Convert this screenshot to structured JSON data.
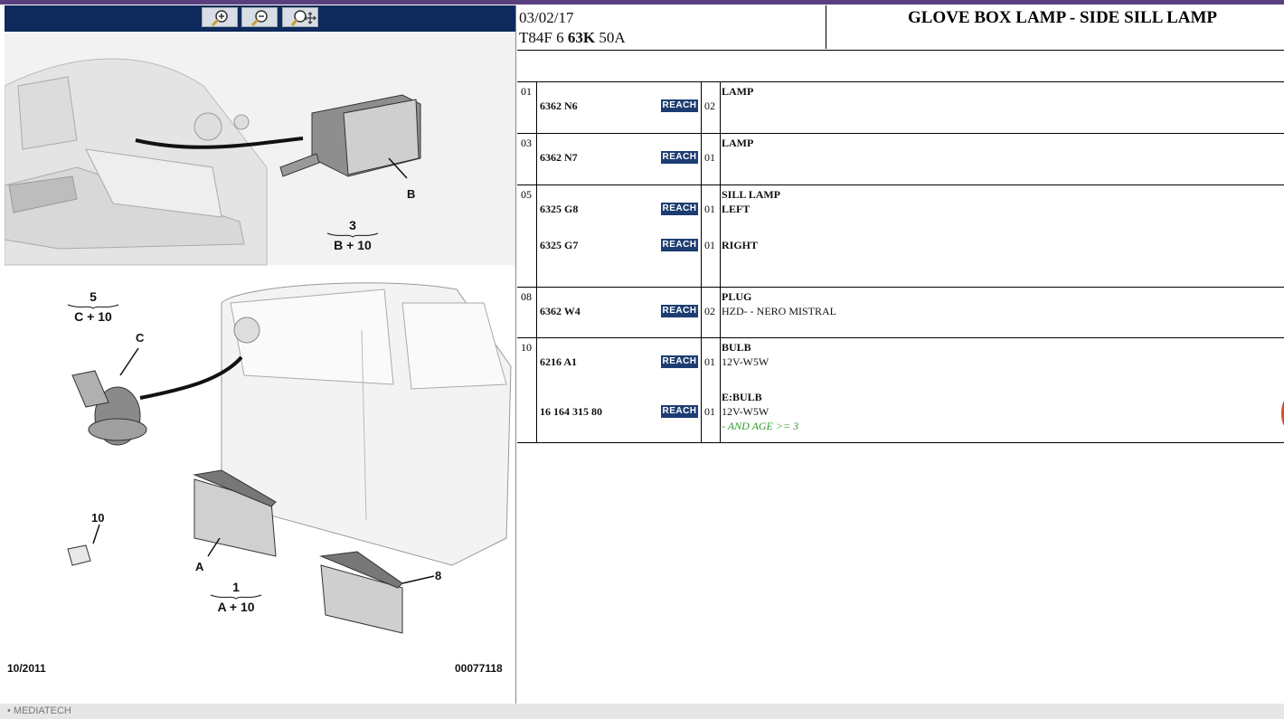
{
  "header": {
    "date": "03/02/17",
    "code_prefix": "T84F 6 ",
    "code_bold": "63K",
    "code_suffix": " 50A",
    "title": "GLOVE BOX LAMP - SIDE SILL LAMP"
  },
  "toolbar": {
    "zoom_in": "zoom-in-icon",
    "zoom_out": "zoom-out-icon",
    "zoom_move": "zoom-move-icon"
  },
  "diagram": {
    "callouts": {
      "b": "B",
      "c": "C",
      "a": "A",
      "n10": "10",
      "n8": "8"
    },
    "fractions": [
      {
        "num": "3",
        "den": "B + 10"
      },
      {
        "num": "5",
        "den": "C + 10"
      },
      {
        "num": "1",
        "den": "A + 10"
      }
    ],
    "footer_left": "10/2011",
    "footer_right": "00077118"
  },
  "reach_label": "REACH",
  "parts": [
    {
      "idx": "01",
      "rows": [
        {
          "ref": "6362 N6",
          "qty": "02",
          "lines": [
            {
              "t": "LAMP",
              "s": "b"
            }
          ]
        }
      ]
    },
    {
      "idx": "03",
      "rows": [
        {
          "ref": "6362 N7",
          "qty": "01",
          "lines": [
            {
              "t": "LAMP",
              "s": "b"
            }
          ]
        }
      ]
    },
    {
      "idx": "05",
      "rows": [
        {
          "ref": "6325 G8",
          "qty": "01",
          "lines": [
            {
              "t": "SILL LAMP",
              "s": "b"
            },
            {
              "t": "LEFT",
              "s": "b"
            }
          ]
        },
        {
          "ref": "6325 G7",
          "qty": "01",
          "lines": [
            {
              "t": "RIGHT",
              "s": "b"
            }
          ]
        }
      ]
    },
    {
      "idx": "08",
      "rows": [
        {
          "ref": "6362 W4",
          "qty": "02",
          "lines": [
            {
              "t": "PLUG",
              "s": "b"
            },
            {
              "t": "HZD- - NERO MISTRAL",
              "s": "n"
            }
          ]
        }
      ]
    },
    {
      "idx": "10",
      "rows": [
        {
          "ref": "6216 A1",
          "qty": "01",
          "lines": [
            {
              "t": "BULB",
              "s": "b"
            },
            {
              "t": "12V-W5W",
              "s": "n"
            }
          ]
        },
        {
          "ref": "16 164 315 80",
          "qty": "01",
          "lines": [
            {
              "t": "E:BULB",
              "s": "b"
            },
            {
              "t": "12V-W5W",
              "s": "n"
            },
            {
              "t": "- AND AGE >= 3",
              "s": "g"
            }
          ]
        }
      ]
    }
  ],
  "bottom_strip": "• MEDIATECH"
}
